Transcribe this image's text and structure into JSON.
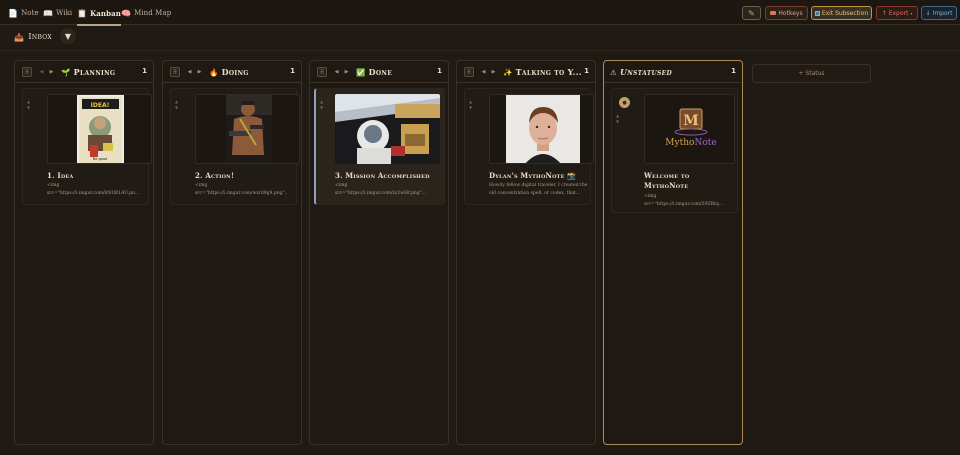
{
  "tabs": [
    {
      "icon": "📄",
      "label": "Note"
    },
    {
      "icon": "📖",
      "label": "Wiki"
    },
    {
      "icon": "📋",
      "label": "Kanban"
    },
    {
      "icon": "🧠",
      "label": "Mind Map"
    }
  ],
  "toolbar": {
    "pencil_icon": "✎",
    "hotkeys_label": "Hotkeys",
    "exit_label": "Exit Subsection",
    "export_label": "Export",
    "import_label": "Import"
  },
  "inbox": {
    "icon": "📥",
    "label": "Inbox",
    "caret": "▼"
  },
  "columns": [
    {
      "icon": "🌱",
      "title": "Planning",
      "count": "1",
      "card": {
        "title": "1. Idea",
        "snippet": "<img src=\"https://i.imgur.com/kNLWL4U.pn..."
      }
    },
    {
      "icon": "🔥",
      "title": "Doing",
      "count": "1",
      "card": {
        "title": "2. Action!",
        "snippet": "<img src=\"https://i.imgur.com/wzrd9g9.png\"..."
      }
    },
    {
      "icon": "✅",
      "title": "Done",
      "count": "1",
      "card": {
        "title": "3. Mission Accomplished",
        "snippet": "<img src=\"https://i.imgur.com/zy2wHf.png\"..."
      }
    },
    {
      "icon": "✨",
      "title": "Talking to Y...",
      "count": "1",
      "card": {
        "title": "Dylan's MythoNote 📸",
        "snippet": "Howdy fellow digital traveler, I created the old concentration spell, or codex, that..."
      }
    },
    {
      "icon": "⚠",
      "title": "Unstatused",
      "count": "1",
      "card": {
        "title_line1": "Welcome to",
        "title_line2": "MythoNote",
        "snippet": "<img src=\"https://i.imgur.com/Z9ZRtq...",
        "logo_letter": "M",
        "logo_word_a": "Mytho",
        "logo_word_b": "Note"
      }
    }
  ],
  "add_status_label": "+ Status",
  "colors": {
    "background": "#201a15",
    "accent_gold": "#c4953b",
    "export_red": "#e07060",
    "import_blue": "#7cb4e0"
  }
}
